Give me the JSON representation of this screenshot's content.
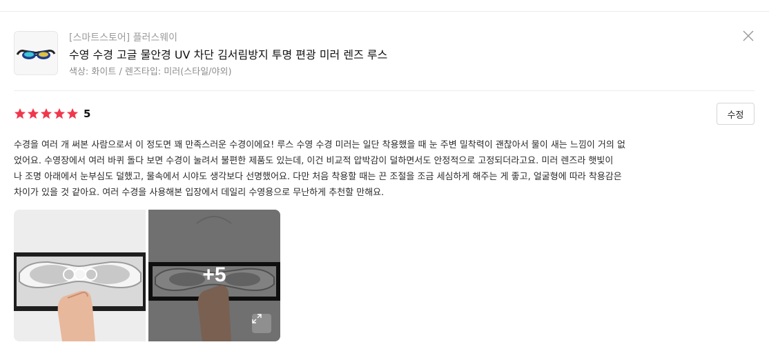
{
  "product": {
    "store": "[스마트스토어] 플러스웨이",
    "name": "수영 수경 고글 물안경 UV 차단 김서림방지 투명 편광 미러 렌즈 루스",
    "option": "색상: 화이트 / 렌즈타입: 미러(스타일/야외)"
  },
  "rating": {
    "stars": 5,
    "score": "5",
    "star_color": "#f0374c"
  },
  "edit_button": "수정",
  "review": {
    "lines": [
      "수경을 여러 개 써본 사람으로서 이 정도면 꽤 만족스러운 수경이에요! 루스 수영 수경 미러는 일단 착용했을 때 눈 주변 밀착력이 괜찮아서 물이 새는 느낌이 거의 없",
      "었어요. 수영장에서 여러 바퀴 돌다 보면 수경이 눌려서 불편한 제품도 있는데, 이건 비교적 압박감이 덜하면서도 안정적으로 고정되더라고요. 미러 렌즈라 햇빛이",
      "나 조명 아래에서 눈부심도 덜했고, 물속에서 시야도 생각보다 선명했어요. 다만 처음 착용할 때는 끈 조절을 조금 세심하게 해주는 게 좋고, 얼굴형에 따라 착용감은",
      "차이가 있을 것 같아요. 여러 수경을 사용해본 입장에서 데일리 수영용으로 무난하게 추천할 만해요."
    ]
  },
  "photos": {
    "more_count": "+5"
  },
  "icons": {
    "close": "close-icon",
    "star": "star-icon",
    "expand": "expand-icon"
  }
}
